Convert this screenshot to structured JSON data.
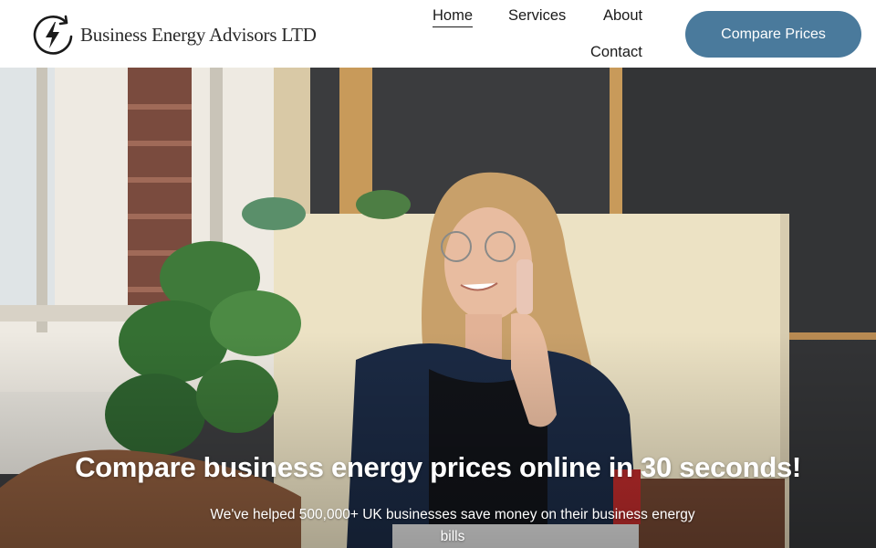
{
  "brand": {
    "name": "Business Energy Advisors LTD",
    "logo_icon": "lightning-bolt-refresh-icon"
  },
  "nav": {
    "items": [
      {
        "label": "Home",
        "active": true
      },
      {
        "label": "Services",
        "active": false
      },
      {
        "label": "About",
        "active": false
      },
      {
        "label": "Contact",
        "active": false
      }
    ],
    "cta_label": "Compare Prices"
  },
  "hero": {
    "title": "Compare business energy prices online in 30 seconds!",
    "subtitle": "We've helped 500,000+ UK businesses save money on their business energy bills"
  },
  "colors": {
    "accent": "#4a7a9c",
    "header_bg": "#ffffff",
    "text": "#1a1a1a",
    "hero_text": "#ffffff"
  }
}
